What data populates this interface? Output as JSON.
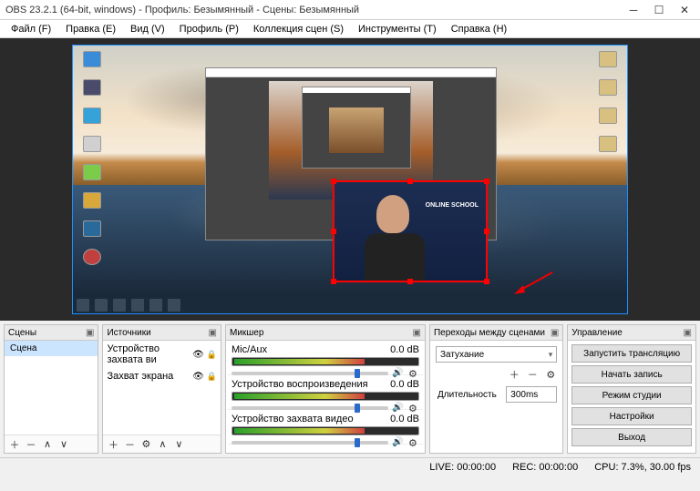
{
  "window": {
    "title": "OBS 23.2.1 (64-bit, windows) - Профиль: Безымянный - Сцены: Безымянный"
  },
  "menubar": [
    "Файл (F)",
    "Правка (E)",
    "Вид (V)",
    "Профиль (P)",
    "Коллекция сцен (S)",
    "Инструменты (T)",
    "Справка (H)"
  ],
  "webcam_text": "ONLINE\nSCHOOL",
  "docks": {
    "scenes": {
      "title": "Сцены",
      "items": [
        "Сцена"
      ]
    },
    "sources": {
      "title": "Источники",
      "items": [
        "Устройство захвата ви",
        "Захват экрана"
      ]
    },
    "mixer": {
      "title": "Микшер",
      "channels": [
        {
          "name": "Mic/Aux",
          "db": "0.0 dB"
        },
        {
          "name": "Устройство воспроизведения",
          "db": "0.0 dB"
        },
        {
          "name": "Устройство захвата видео",
          "db": "0.0 dB"
        }
      ]
    },
    "transitions": {
      "title": "Переходы между сценами",
      "selected": "Затухание",
      "duration_label": "Длительность",
      "duration": "300ms"
    },
    "controls": {
      "title": "Управление",
      "buttons": [
        "Запустить трансляцию",
        "Начать запись",
        "Режим студии",
        "Настройки",
        "Выход"
      ]
    }
  },
  "status": {
    "live": "LIVE: 00:00:00",
    "rec": "REC: 00:00:00",
    "cpu": "CPU: 7.3%, 30.00 fps"
  }
}
